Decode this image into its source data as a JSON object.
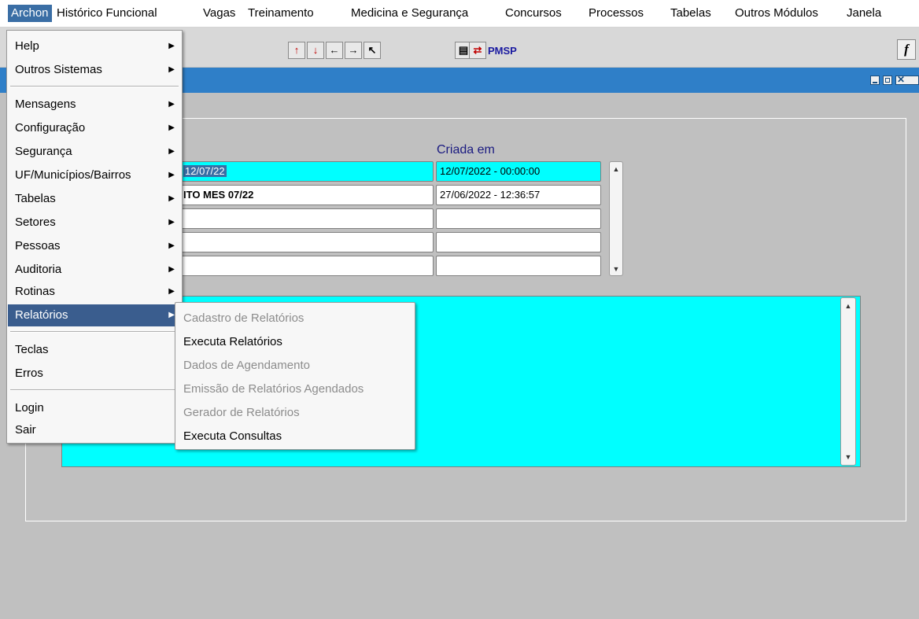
{
  "menubar": {
    "items": [
      "Archon",
      "Histórico Funcional",
      "Vagas",
      "Treinamento",
      "Medicina e Segurança",
      "Concursos",
      "Processos",
      "Tabelas",
      "Outros Módulos",
      "Janela"
    ]
  },
  "toolbar": {
    "pmsp_label": "PMSP",
    "function_label": "f",
    "icons": [
      "up-r-icon",
      "down-r-icon",
      "arrow-left-icon",
      "arrow-right-icon",
      "help-cursor-icon",
      "report-icon",
      "emp-icon"
    ]
  },
  "grid": {
    "header_created": "Criada em",
    "rows": [
      {
        "name": "12/07/22",
        "created": "12/07/2022  -  00:00:00"
      },
      {
        "name": "ITO MES 07/22",
        "created": "27/06/2022  -  12:36:57"
      },
      {
        "name": "",
        "created": ""
      },
      {
        "name": "",
        "created": ""
      },
      {
        "name": "",
        "created": ""
      }
    ]
  },
  "menu": {
    "items": [
      {
        "label": "Help",
        "submenu": true
      },
      {
        "label": "Outros Sistemas",
        "submenu": true
      },
      {
        "label": "Mensagens",
        "submenu": true
      },
      {
        "label": "Configuração",
        "submenu": true
      },
      {
        "label": "Segurança",
        "submenu": true
      },
      {
        "label": "UF/Municípios/Bairros",
        "submenu": true
      },
      {
        "label": "Tabelas",
        "submenu": true
      },
      {
        "label": "Setores",
        "submenu": true
      },
      {
        "label": "Pessoas",
        "submenu": true
      },
      {
        "label": "Auditoria",
        "submenu": true
      },
      {
        "label": "Rotinas",
        "submenu": true
      },
      {
        "label": "Relatórios",
        "submenu": true,
        "active": true
      },
      {
        "label": "Teclas",
        "submenu": false
      },
      {
        "label": "Erros",
        "submenu": false
      },
      {
        "label": "Login",
        "submenu": false
      },
      {
        "label": "Sair",
        "submenu": false
      }
    ]
  },
  "submenu": {
    "items": [
      {
        "label": "Cadastro de Relatórios",
        "enabled": false
      },
      {
        "label": "Executa Relatórios",
        "enabled": true
      },
      {
        "label": "Dados de Agendamento",
        "enabled": false
      },
      {
        "label": "Emissão de Relatórios Agendados",
        "enabled": false
      },
      {
        "label": "Gerador de Relatórios",
        "enabled": false
      },
      {
        "label": "Executa Consultas",
        "enabled": true
      }
    ]
  },
  "colors": {
    "title_bar": "#2f7fc8",
    "selection": "#3a6ea5",
    "field_highlight": "#00ffff",
    "background": "#c0c0c0"
  }
}
